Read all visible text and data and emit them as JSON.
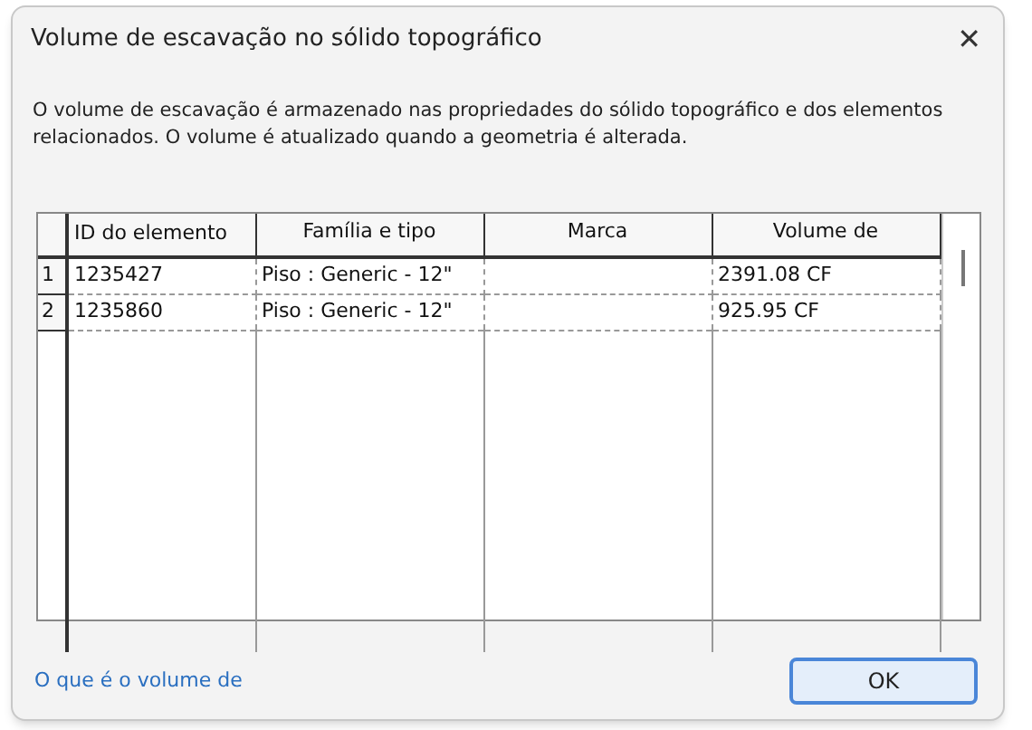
{
  "window": {
    "title": "Volume de escavação no sólido topográfico",
    "close": "✕"
  },
  "description": "O volume de escavação é armazenado nas propriedades do sólido topográfico e dos elementos relacionados. O volume é atualizado quando a geometria é alterada.",
  "table": {
    "columns": [
      "ID do elemento",
      "Família e tipo",
      "Marca",
      "Volume de"
    ],
    "rows": [
      {
        "number": "1",
        "cells": [
          "1235427",
          "Piso : Generic - 12\"",
          "",
          "2391.08 CF"
        ]
      },
      {
        "number": "2",
        "cells": [
          "1235860",
          "Piso : Generic - 12\"",
          "",
          "925.95 CF"
        ]
      }
    ]
  },
  "help_link": "O que é o volume de",
  "buttons": [
    "OK"
  ]
}
